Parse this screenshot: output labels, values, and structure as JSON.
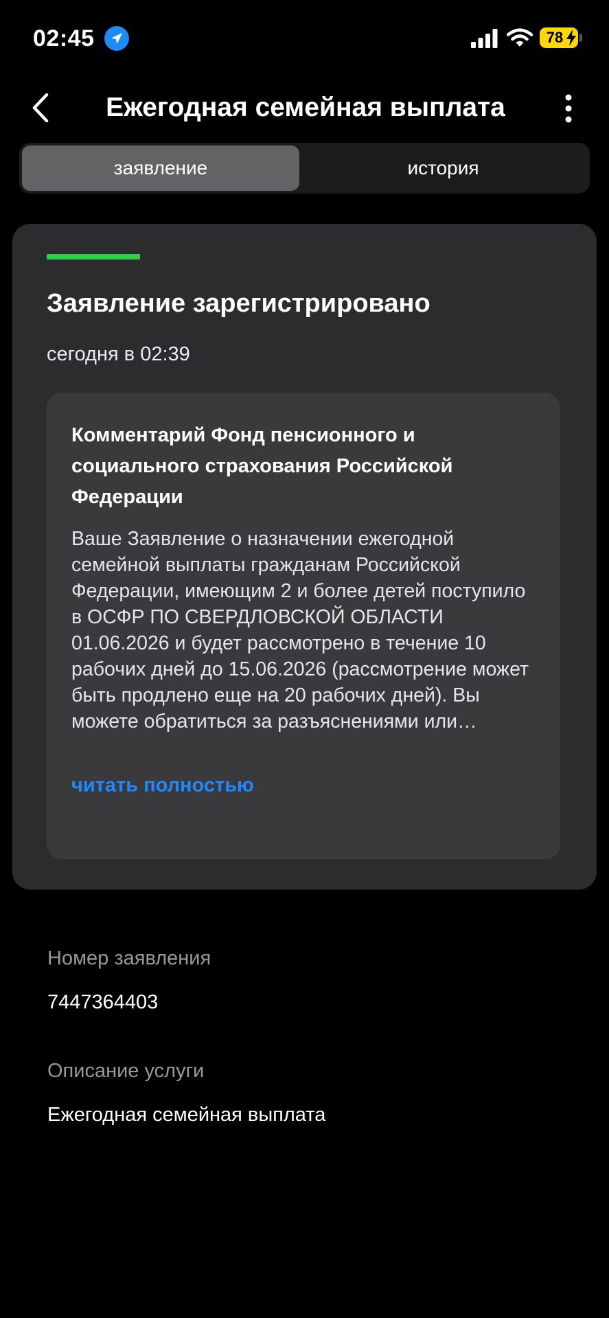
{
  "status_bar": {
    "time": "02:45",
    "battery": "78"
  },
  "header": {
    "title": "Ежегодная семейная выплата"
  },
  "tabs": [
    {
      "label": "заявление",
      "active": true
    },
    {
      "label": "история",
      "active": false
    }
  ],
  "status_card": {
    "title": "Заявление зарегистрировано",
    "date": "сегодня в 02:39",
    "accent_color": "#2bd14b"
  },
  "comment": {
    "title": "Комментарий Фонд пенсионного и социального страхования Российской Федерации",
    "body": "Ваше Заявление о назначении ежегодной семейной выплаты гражданам Российской Федерации, имеющим 2 и более детей поступило в ОСФР ПО СВЕРДЛОВСКОЙ ОБЛАСТИ 01.06.2026 и будет рассмотрено в течение 10 рабочих дней до 15.06.2026 (рассмотрение может быть продлено еще на 20 рабочих дней). Вы можете обратиться за разъяснениями или получением необходимой информации о...",
    "read_more": "читать полностью",
    "link_color": "#1e88ff"
  },
  "details": [
    {
      "label": "Номер заявления",
      "value": "7447364403"
    },
    {
      "label": "Описание услуги",
      "value": "Ежегодная семейная выплата"
    }
  ],
  "icons": {
    "back": "chevron-left-icon",
    "more": "more-vertical-icon",
    "location": "location-arrow-icon",
    "signal": "cellular-signal-icon",
    "wifi": "wifi-icon",
    "battery": "battery-charging-icon"
  }
}
